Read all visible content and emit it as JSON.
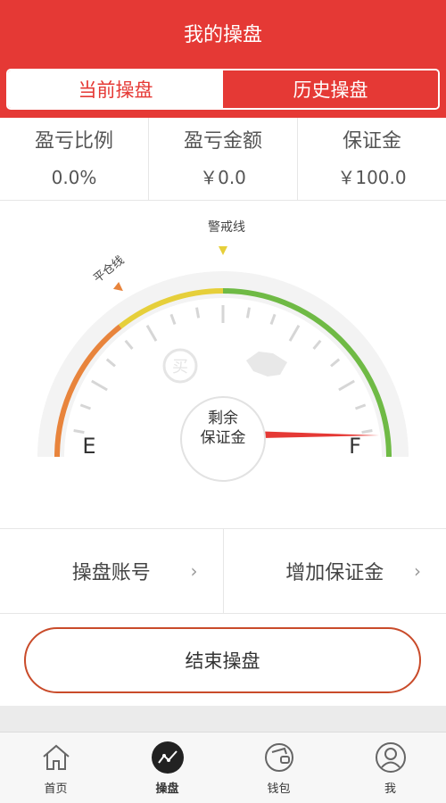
{
  "header": {
    "title": "我的操盘"
  },
  "tabs": [
    {
      "label": "当前操盘",
      "active": true
    },
    {
      "label": "历史操盘",
      "active": false
    }
  ],
  "stats": [
    {
      "label": "盈亏比例",
      "value": "0.0%"
    },
    {
      "label": "盈亏金额",
      "value": "￥0.0"
    },
    {
      "label": "保证金",
      "value": "￥100.0"
    }
  ],
  "gauge": {
    "warning_label": "警戒线",
    "liquidation_label": "平仓线",
    "empty_label": "E",
    "full_label": "F",
    "center_line1": "剩余",
    "center_line2": "保证金",
    "buy_icon_text": "买",
    "remaining_margin_fraction": 1.0,
    "colors": {
      "orange": "#e8843c",
      "yellow": "#e6cf3a",
      "green": "#6fba45",
      "needle": "#e53935"
    }
  },
  "actions": [
    {
      "label": "操盘账号",
      "chevron": "›"
    },
    {
      "label": "增加保证金",
      "chevron": "›"
    }
  ],
  "end_button": {
    "label": "结束操盘"
  },
  "nav": [
    {
      "label": "首页",
      "icon": "home-icon",
      "active": false
    },
    {
      "label": "操盘",
      "icon": "trend-icon",
      "active": true
    },
    {
      "label": "钱包",
      "icon": "wallet-icon",
      "active": false
    },
    {
      "label": "我",
      "icon": "user-icon",
      "active": false
    }
  ],
  "colors": {
    "brand": "#e53935",
    "border": "#e6e6e6"
  }
}
